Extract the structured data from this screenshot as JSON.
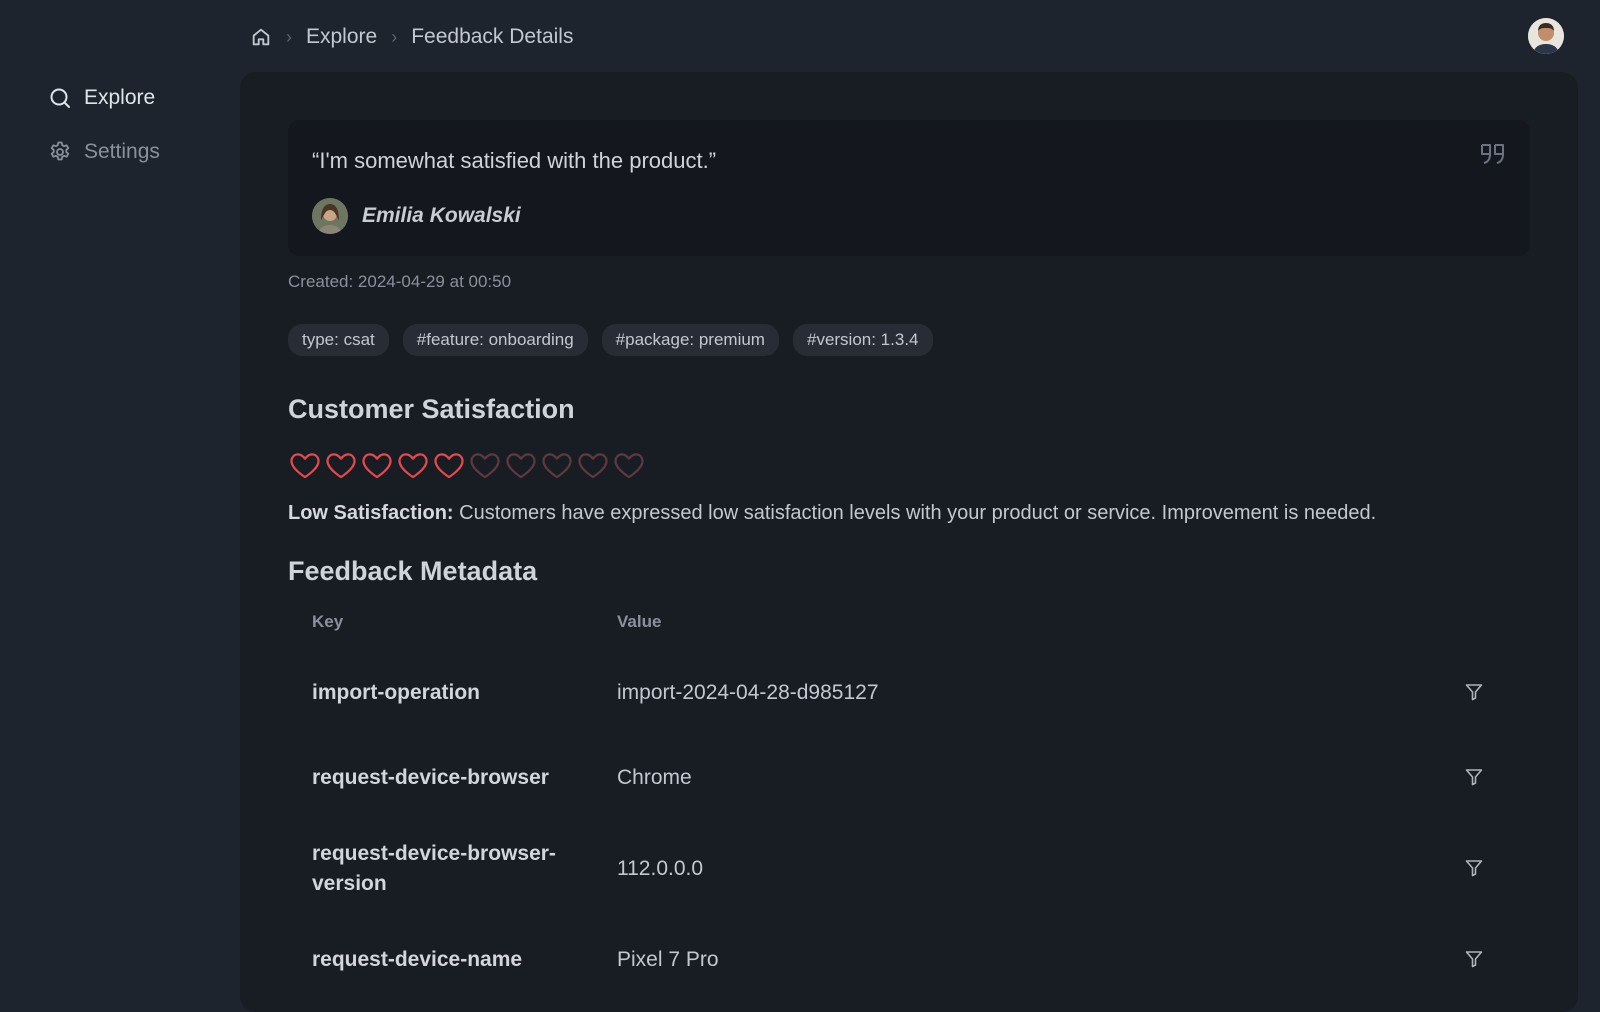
{
  "sidebar": {
    "items": [
      {
        "label": "Explore",
        "icon": "search-icon"
      },
      {
        "label": "Settings",
        "icon": "gear-icon"
      }
    ]
  },
  "breadcrumb": {
    "items": [
      "Explore",
      "Feedback Details"
    ]
  },
  "feedback": {
    "quote": "“I'm somewhat satisfied with the product.”",
    "author": "Emilia Kowalski",
    "created": "Created: 2024-04-29 at 00:50",
    "tags": [
      "type: csat",
      "#feature: onboarding",
      "#package: premium",
      "#version: 1.3.4"
    ]
  },
  "satisfaction": {
    "title": "Customer Satisfaction",
    "rating": 5,
    "max_rating": 10,
    "label": "Low Satisfaction:",
    "description": " Customers have expressed low satisfaction levels with your product or service. Improvement is needed."
  },
  "metadata": {
    "title": "Feedback Metadata",
    "key_header": "Key",
    "value_header": "Value",
    "rows": [
      {
        "key": "import-operation",
        "value": "import-2024-04-28-d985127"
      },
      {
        "key": "request-device-browser",
        "value": "Chrome"
      },
      {
        "key": "request-device-browser-version",
        "value": "112.0.0.0"
      },
      {
        "key": "request-device-name",
        "value": "Pixel 7 Pro"
      }
    ]
  },
  "colors": {
    "heart_filled": "#e5484d",
    "heart_empty": "#5e3a3d",
    "background": "#1e242e",
    "panel": "#181c23"
  }
}
